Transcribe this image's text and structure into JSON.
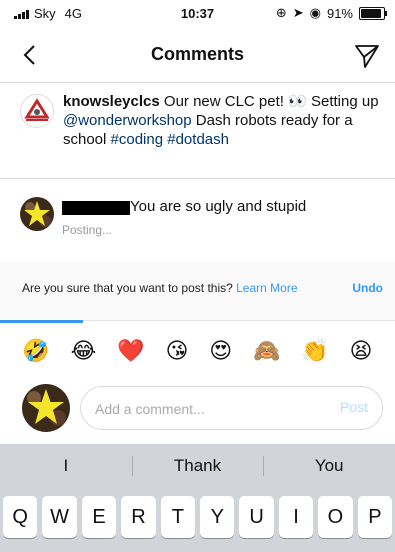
{
  "status_bar": {
    "carrier": "Sky",
    "network": "4G",
    "time": "10:37",
    "battery": "91%",
    "battery_level": 0.91
  },
  "header": {
    "title": "Comments",
    "back_icon": "chevron-left-icon",
    "share_icon": "paper-plane-icon"
  },
  "caption": {
    "username": "knowsleyclcs",
    "text_before": " Our new CLC pet! ",
    "eyes_emoji": "👀",
    "text_middle": " Setting up ",
    "mention": "@wonderworkshop",
    "text_after": " Dash robots ready for a school ",
    "hashtag1": "#coding",
    "hashtag2": "#dotdash"
  },
  "comment": {
    "text": "You are so ugly and stupid",
    "status": "Posting..."
  },
  "warning": {
    "message": "Are you sure that you want to post this? ",
    "learn_more": "Learn More",
    "undo": "Undo",
    "progress": 0.21
  },
  "emoji_bar": [
    "🤣",
    "😂",
    "❤️",
    "😘",
    "😍",
    "🙈",
    "👏",
    "😫"
  ],
  "composer": {
    "placeholder": "Add a comment...",
    "post_label": "Post"
  },
  "keyboard": {
    "suggestions": [
      "I",
      "Thank",
      "You"
    ],
    "row1": [
      "Q",
      "W",
      "E",
      "R",
      "T",
      "Y",
      "U",
      "I",
      "O",
      "P"
    ]
  },
  "colors": {
    "accent": "#3897f0",
    "post_disabled": "#b2dffc",
    "hashtag": "#003569",
    "keyboard_bg": "#d1d4d9"
  }
}
